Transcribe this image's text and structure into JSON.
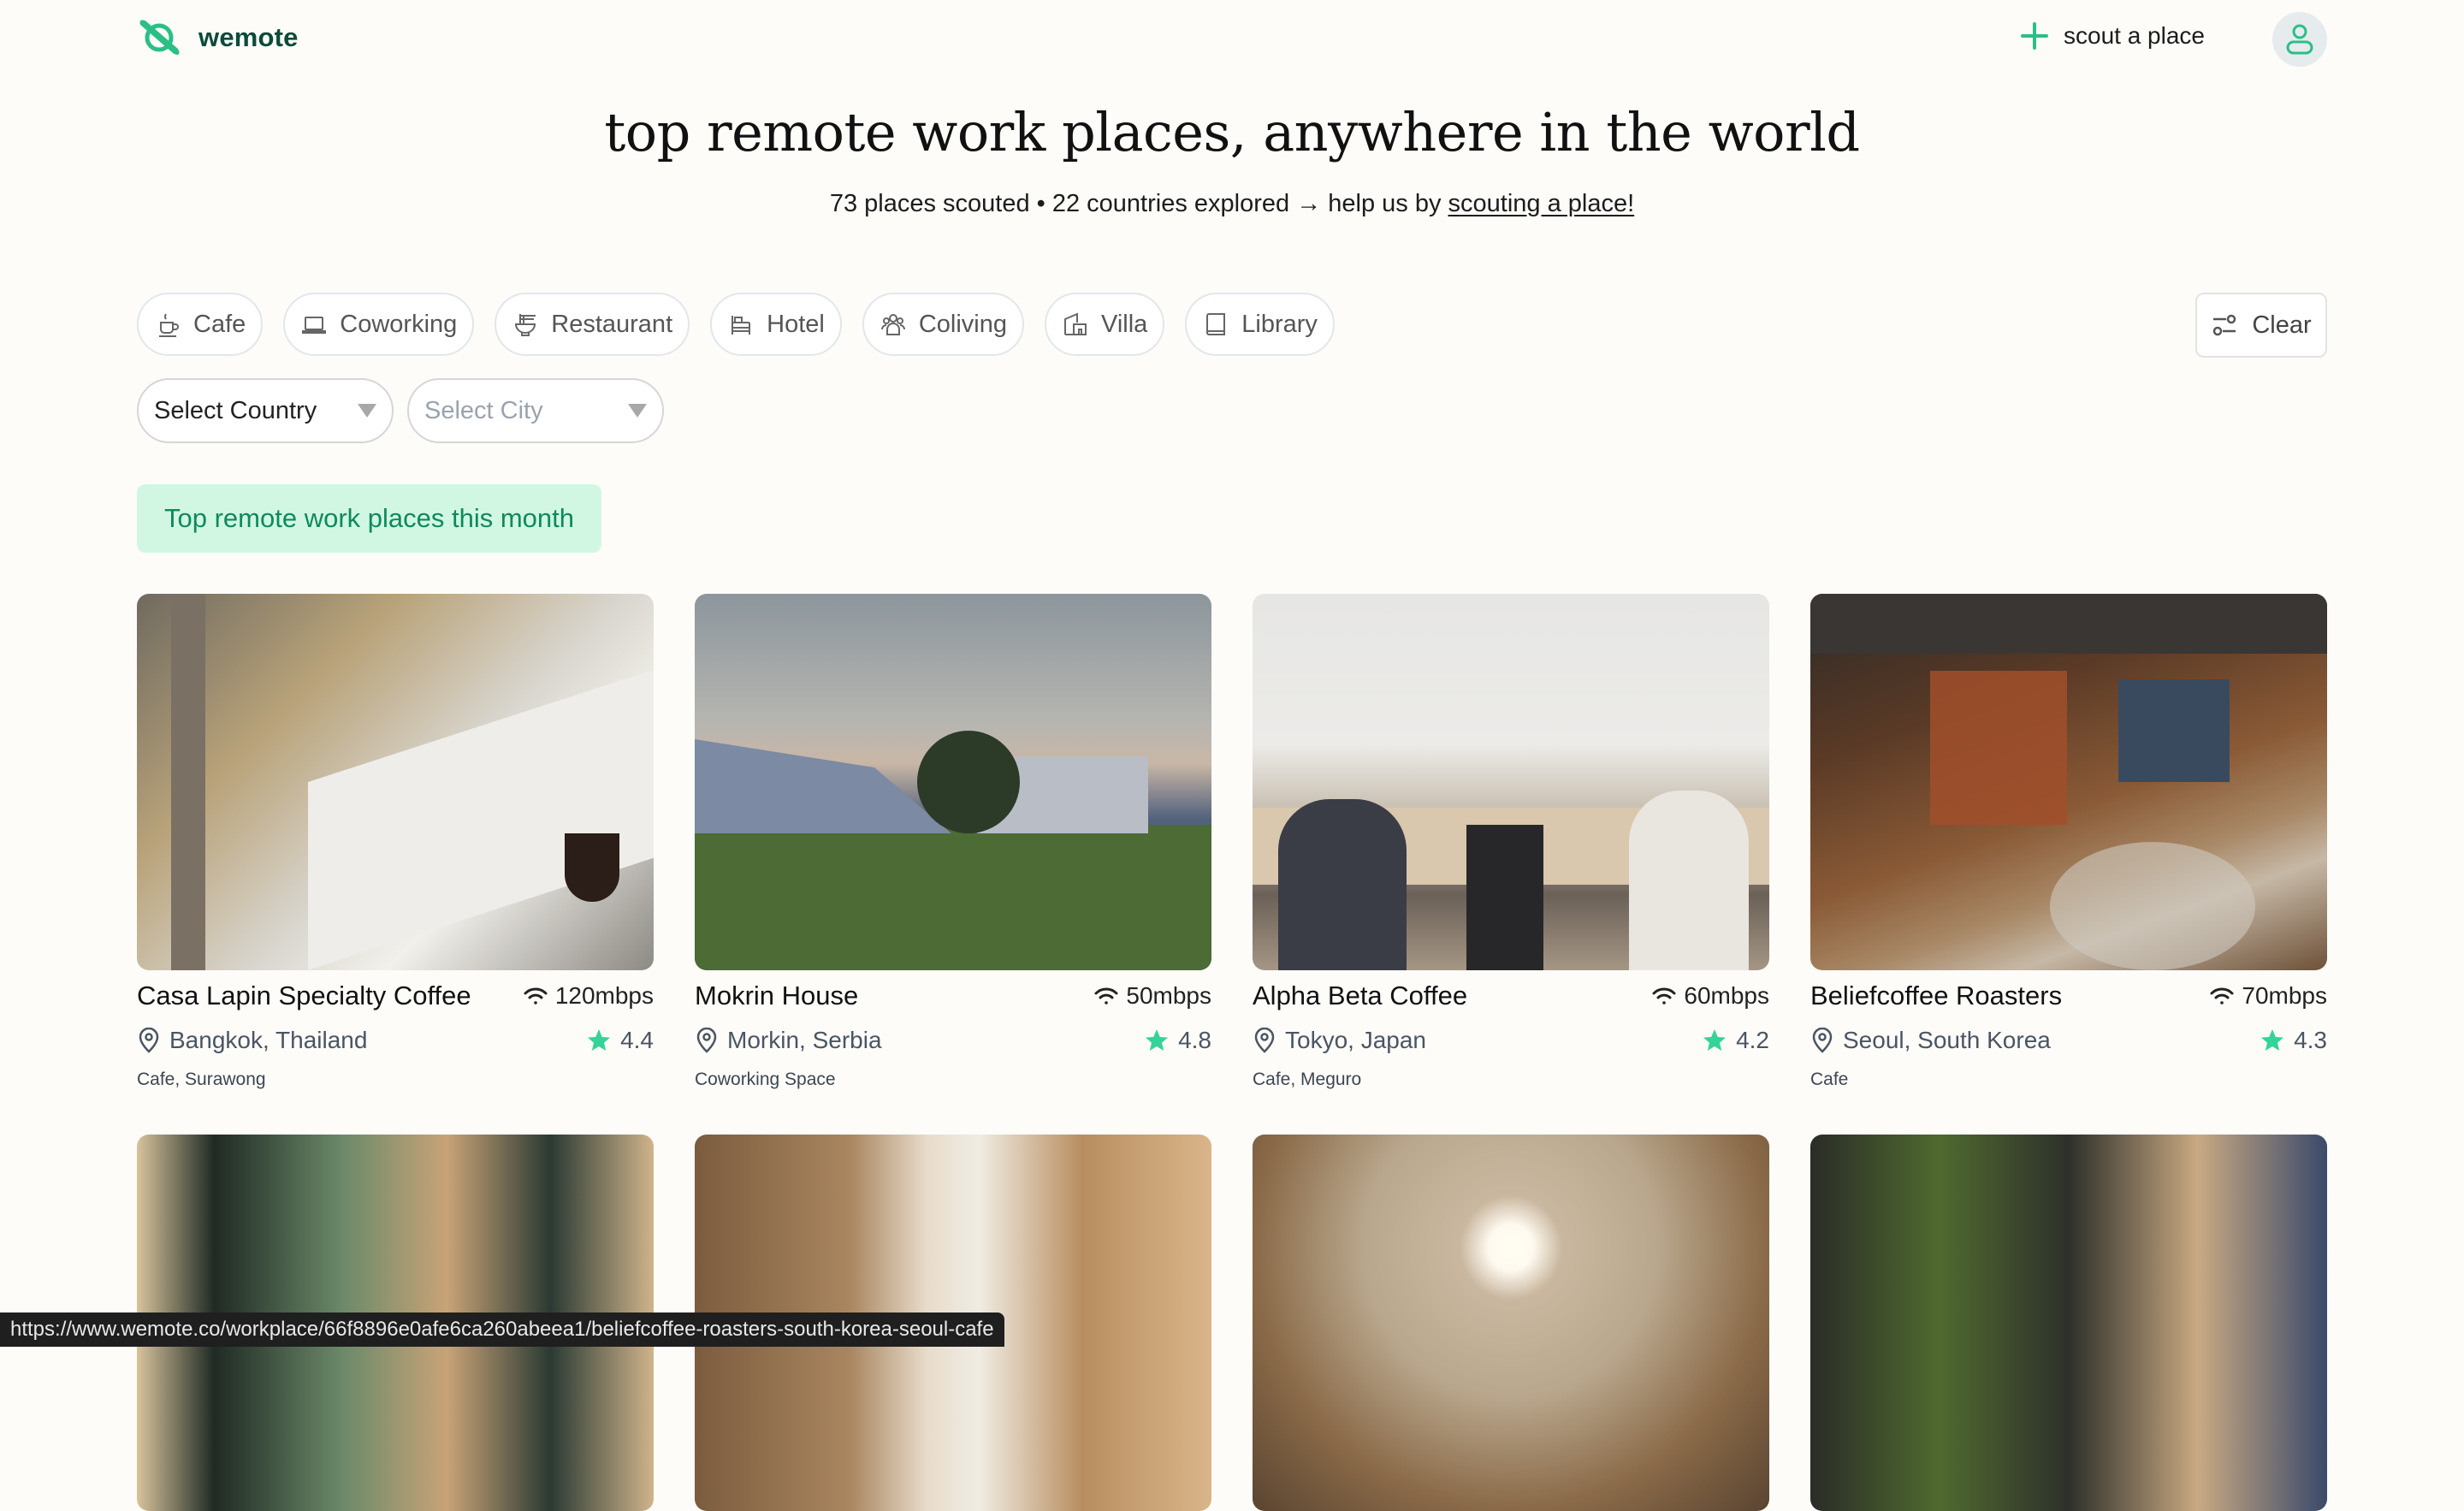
{
  "brand": {
    "name": "wemote",
    "color": "#2bbf86",
    "text_color": "#0d4a3a"
  },
  "header": {
    "scout_label": "scout a place",
    "avatar_icon": "user-icon"
  },
  "hero": {
    "title": "top remote work places, anywhere in the world",
    "subtitle_prefix": "73 places scouted • 22 countries explored → help us by ",
    "subtitle_link": "scouting a place!",
    "places_count": 73,
    "countries_count": 22
  },
  "filters": {
    "categories": [
      {
        "label": "Cafe",
        "icon": "coffee-cup-icon"
      },
      {
        "label": "Coworking",
        "icon": "laptop-icon"
      },
      {
        "label": "Restaurant",
        "icon": "noodle-bowl-icon"
      },
      {
        "label": "Hotel",
        "icon": "bed-icon"
      },
      {
        "label": "Coliving",
        "icon": "people-icon"
      },
      {
        "label": "Villa",
        "icon": "house-icon"
      },
      {
        "label": "Library",
        "icon": "book-icon"
      }
    ],
    "clear_label": "Clear",
    "country_select": {
      "value": "Select Country"
    },
    "city_select": {
      "placeholder": "Select City"
    }
  },
  "section": {
    "title": "Top remote work places this month",
    "badge_bg": "#d1f7e3",
    "badge_text": "#0e8a5a"
  },
  "places": [
    {
      "name": "Casa Lapin Specialty Coffee",
      "wifi": "120mbps",
      "location": "Bangkok, Thailand",
      "rating": "4.4",
      "tags": "Cafe, Surawong"
    },
    {
      "name": "Mokrin House",
      "wifi": "50mbps",
      "location": "Morkin, Serbia",
      "rating": "4.8",
      "tags": "Coworking Space"
    },
    {
      "name": "Alpha Beta Coffee",
      "wifi": "60mbps",
      "location": "Tokyo, Japan",
      "rating": "4.2",
      "tags": "Cafe, Meguro"
    },
    {
      "name": "Beliefcoffee Roasters",
      "wifi": "70mbps",
      "location": "Seoul, South Korea",
      "rating": "4.3",
      "tags": "Cafe"
    }
  ],
  "rating_star_color": "#34d399",
  "status_url": "https://www.wemote.co/workplace/66f8896e0afe6ca260abeea1/beliefcoffee-roasters-south-korea-seoul-cafe"
}
